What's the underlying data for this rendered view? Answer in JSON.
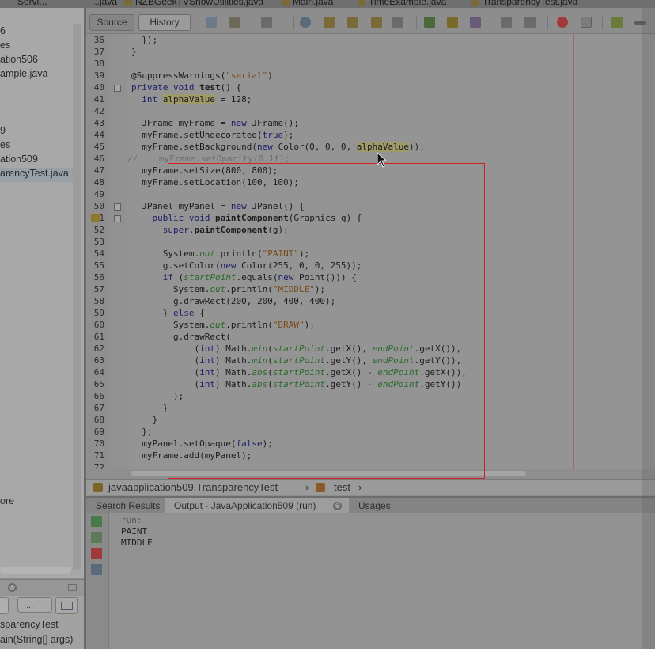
{
  "file_tabs": [
    "...java",
    "Servi...",
    "NZBGeekTVShowUtilities.java",
    "Main.java",
    "TimeExample.java",
    "TransparencyTest.java"
  ],
  "left_tree": [
    "6",
    "es",
    "ation506",
    "ample.java",
    "9",
    "es",
    "ation509",
    "arencyTest.java",
    "ore"
  ],
  "nav": {
    "close_glyph": "⊗",
    "combo_value": "...",
    "items": [
      "sparencyTest",
      "ain(String[] args)"
    ]
  },
  "toolbar": {
    "source_label": "Source",
    "history_label": "History"
  },
  "editor": {
    "line_numbers": [
      "36",
      "37",
      "38",
      "39",
      "40",
      "41",
      "42",
      "43",
      "44",
      "45",
      "46",
      "47",
      "48",
      "49",
      "50",
      "51",
      "52",
      "53",
      "54",
      "55",
      "56",
      "57",
      "58",
      "59",
      "60",
      "61",
      "62",
      "63",
      "64",
      "65",
      "66",
      "67",
      "68",
      "69",
      "70",
      "71",
      "72"
    ],
    "lines": [
      "  });",
      "}",
      "",
      "@SuppressWarnings(\"serial\")",
      "private void test() {",
      "  int alphaValue = 128;",
      "",
      "  JFrame myFrame = new JFrame();",
      "  myFrame.setUndecorated(true);",
      "  myFrame.setBackground(new Color(0, 0, 0, alphaValue));",
      "//    myFrame.setOpacity(0.1f);",
      "  myFrame.setSize(800, 800);",
      "  myFrame.setLocation(100, 100);",
      "",
      "  JPanel myPanel = new JPanel() {",
      "    public void paintComponent(Graphics g) {",
      "      super.paintComponent(g);",
      "",
      "      System.out.println(\"PAINT\");",
      "      g.setColor(new Color(255, 0, 0, 255));",
      "      if (startPoint.equals(new Point())) {",
      "        System.out.println(\"MIDDLE\");",
      "        g.drawRect(200, 200, 400, 400);",
      "      } else {",
      "        System.out.println(\"DRAW\");",
      "        g.drawRect(",
      "            (int) Math.min(startPoint.getX(), endPoint.getX()),",
      "            (int) Math.min(startPoint.getY(), endPoint.getY()),",
      "            (int) Math.abs(startPoint.getX() - endPoint.getX()),",
      "            (int) Math.abs(startPoint.getY() - endPoint.getY())",
      "        );",
      "      }",
      "    }",
      "  };",
      "  myPanel.setOpaque(false);",
      "  myFrame.add(myPanel);",
      ""
    ]
  },
  "breadcrumb": {
    "class_path": "javaapplication509.TransparencyTest",
    "method": "test",
    "separator": "›"
  },
  "output": {
    "tabs": [
      "Search Results",
      "Output - JavaApplication509 (run)",
      "Usages"
    ],
    "close_glyph": "⊗",
    "lines": [
      "run:",
      "PAINT",
      "MIDDLE"
    ]
  },
  "colors": {
    "overlay_rect": "#d42020"
  }
}
